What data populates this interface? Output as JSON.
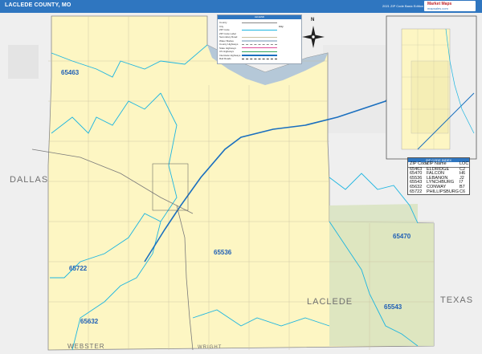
{
  "header": {
    "title": "LACLEDE COUNTY, MO",
    "edition": "2021 ZIP Code Basic Edition",
    "brand_line1": "Market Maps",
    "brand_line2": "mapsales.com"
  },
  "legend": {
    "title": "LEGEND",
    "rows": [
      {
        "label": "County",
        "value": ""
      },
      {
        "label": "City",
        "value": ""
      },
      {
        "label": "ZIP Code",
        "value": ""
      },
      {
        "label": "ZIP Code Label",
        "value": ""
      },
      {
        "label": "Secondary Road",
        "value": ""
      },
      {
        "label": "Water Bodies",
        "value": ""
      },
      {
        "label": "County Highways",
        "value": ""
      },
      {
        "label": "State Highways",
        "value": ""
      },
      {
        "label": "US Highways",
        "value": ""
      },
      {
        "label": "Interstate Highways",
        "value": ""
      },
      {
        "label": "Rail Roads",
        "value": ""
      }
    ],
    "city_sample": "City"
  },
  "map": {
    "land_color": "#fdf6c3",
    "forest_color": "#d8e3bf",
    "outside_color": "#efefef",
    "water_color": "#b5c8d8",
    "zip_boundary_color": "#1cb5e0",
    "interstate_color": "#1a6fbf",
    "county_names": [
      "DALLAS",
      "LACLEDE",
      "TEXAS",
      "WEBSTER",
      "WRIGHT"
    ],
    "zip_labels": [
      "65463",
      "65536",
      "65722",
      "65470",
      "65543",
      "65632"
    ],
    "compass_label": "N"
  },
  "inset_table": {
    "title": "ZIP CODE INDEX",
    "headers": [
      "ZIP Code",
      "ZIP Name",
      "LOC"
    ],
    "rows": [
      [
        "65463",
        "ELDRIDGE",
        "C2"
      ],
      [
        "65470",
        "FALCON",
        "H6"
      ],
      [
        "65536",
        "LEBANON",
        "J2"
      ],
      [
        "65543",
        "LYNCHBURG",
        "I7"
      ],
      [
        "65632",
        "CONWAY",
        "B7"
      ],
      [
        "65722",
        "PHILLIPSBURG",
        "C6"
      ]
    ]
  }
}
